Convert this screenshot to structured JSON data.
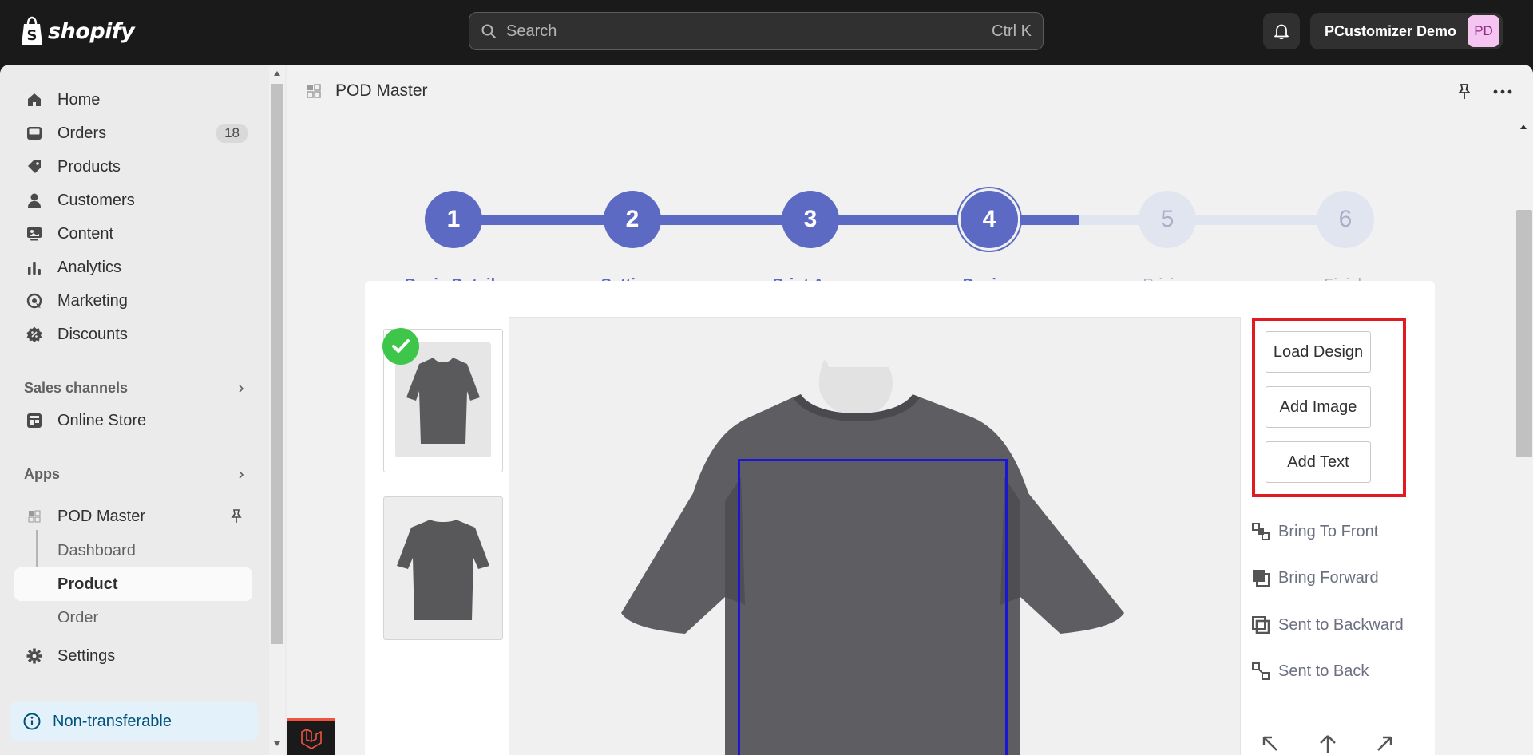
{
  "topbar": {
    "brand": "shopify",
    "search_placeholder": "Search",
    "search_shortcut": "Ctrl K",
    "account_name": "PCustomizer Demo",
    "account_initials": "PD"
  },
  "sidebar": {
    "items": [
      {
        "label": "Home",
        "icon": "home-icon"
      },
      {
        "label": "Orders",
        "icon": "orders-icon",
        "badge": "18"
      },
      {
        "label": "Products",
        "icon": "tag-icon"
      },
      {
        "label": "Customers",
        "icon": "person-icon"
      },
      {
        "label": "Content",
        "icon": "content-icon"
      },
      {
        "label": "Analytics",
        "icon": "analytics-icon"
      },
      {
        "label": "Marketing",
        "icon": "marketing-icon"
      },
      {
        "label": "Discounts",
        "icon": "discount-icon"
      }
    ],
    "sales_channels_label": "Sales channels",
    "online_store_label": "Online Store",
    "apps_label": "Apps",
    "app_name": "POD Master",
    "app_sub_items": [
      "Dashboard",
      "Product",
      "Order"
    ],
    "settings_label": "Settings",
    "non_transferable_label": "Non-transferable"
  },
  "app_header": {
    "title": "POD Master"
  },
  "stepper": {
    "steps": [
      {
        "number": "1",
        "label": "Basic Details",
        "state": "done"
      },
      {
        "number": "2",
        "label": "Settings",
        "state": "done"
      },
      {
        "number": "3",
        "label": "Print Area",
        "state": "done"
      },
      {
        "number": "4",
        "label": "Design",
        "state": "current"
      },
      {
        "number": "5",
        "label": "Pricing",
        "state": "todo"
      },
      {
        "number": "6",
        "label": "Finish",
        "state": "todo"
      }
    ]
  },
  "design_tools": {
    "load_design": "Load Design",
    "add_image": "Add Image",
    "add_text": "Add Text",
    "bring_to_front": "Bring To Front",
    "bring_forward": "Bring Forward",
    "sent_to_backward": "Sent to Backward",
    "sent_to_back": "Sent to Back"
  },
  "colors": {
    "accent": "#5c6ac4",
    "step_todo": "#e1e5f0",
    "print_area_border": "#1b16d6",
    "highlight_border": "#e01b22",
    "selected_check": "#3ec64a",
    "tshirt": "#5a5a5c"
  }
}
